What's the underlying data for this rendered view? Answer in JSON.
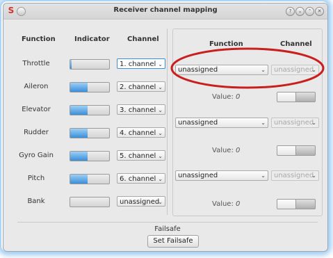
{
  "window": {
    "title": "Receiver channel mapping",
    "app_icon": "S",
    "controls": [
      "?",
      "⌄",
      "⌃",
      "✕"
    ]
  },
  "left": {
    "headers": {
      "function": "Function",
      "indicator": "Indicator",
      "channel": "Channel"
    },
    "rows": [
      {
        "function": "Throttle",
        "indicator_level": 0.03,
        "channel": "1. channel"
      },
      {
        "function": "Aileron",
        "indicator_level": 0.45,
        "channel": "2. channel"
      },
      {
        "function": "Elevator",
        "indicator_level": 0.45,
        "channel": "3. channel"
      },
      {
        "function": "Rudder",
        "indicator_level": 0.45,
        "channel": "4. channel"
      },
      {
        "function": "Gyro Gain",
        "indicator_level": 0.45,
        "channel": "5. channel"
      },
      {
        "function": "Pitch",
        "indicator_level": 0.45,
        "channel": "6. channel"
      },
      {
        "function": "Bank",
        "indicator_level": 0.0,
        "channel": "unassigned"
      }
    ]
  },
  "right": {
    "headers": {
      "function": "Function",
      "channel": "Channel"
    },
    "groups": [
      {
        "function": "unassigned",
        "channel": "unassigned",
        "value_label": "Value:",
        "value": "0"
      },
      {
        "function": "unassigned",
        "channel": "unassigned",
        "value_label": "Value:",
        "value": "0"
      },
      {
        "function": "unassigned",
        "channel": "unassigned",
        "value_label": "Value:",
        "value": "0"
      }
    ]
  },
  "failsafe": {
    "label": "Failsafe",
    "button": "Set Failsafe"
  },
  "annotation": {
    "color": "#c8201e"
  },
  "colors": {
    "accent": "#3a8fd8"
  }
}
